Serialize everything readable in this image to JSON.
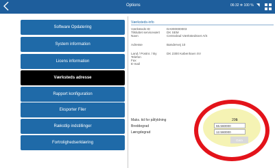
{
  "topbar": {
    "title": "Options",
    "time": "06:32",
    "battery": "100 %",
    "bluetooth_icon": "bluetooth-icon",
    "wifi_icon": "wifi-icon",
    "back_icon": "back-arrow-icon",
    "grid_icon": "grid-icon"
  },
  "menu": [
    {
      "label": "Software Opdatering"
    },
    {
      "label": "System information"
    },
    {
      "label": "Licens information"
    },
    {
      "label": "Værksteds adresse"
    },
    {
      "label": "Rapport konfiguration"
    },
    {
      "label": "Eksporter Filer"
    },
    {
      "label": "Rækstlip indstillinger"
    },
    {
      "label": "Fortrolighedserklæring"
    }
  ],
  "details": {
    "title": "Værksteds-info",
    "rows": [
      {
        "label": "Værksteds ID",
        "value": "DA000000003"
      },
      {
        "label": "Tilsluttet servicevært",
        "value": "DK SEM"
      },
      {
        "label": "Navn",
        "value": "Centralrad Værkstedsnet A/S"
      },
      {
        "label": "Adresse",
        "value": "Bøndervej 10"
      },
      {
        "label": "Land / Postnr. / By",
        "value": "DK 2300 København SV"
      },
      {
        "label": "Telefon",
        "value": ""
      },
      {
        "label": "Fax",
        "value": ""
      },
      {
        "label": "E-mail",
        "value": ""
      }
    ]
  },
  "location": {
    "max_label": "Maks. tid for påfyldning",
    "max_value": "200",
    "unit": "s",
    "latitude_label": "Breddegrad",
    "latitude_value": "55.560000",
    "longitude_label": "Længdegrad",
    "longitude_value": "12.560000",
    "save_label": "Gem"
  }
}
